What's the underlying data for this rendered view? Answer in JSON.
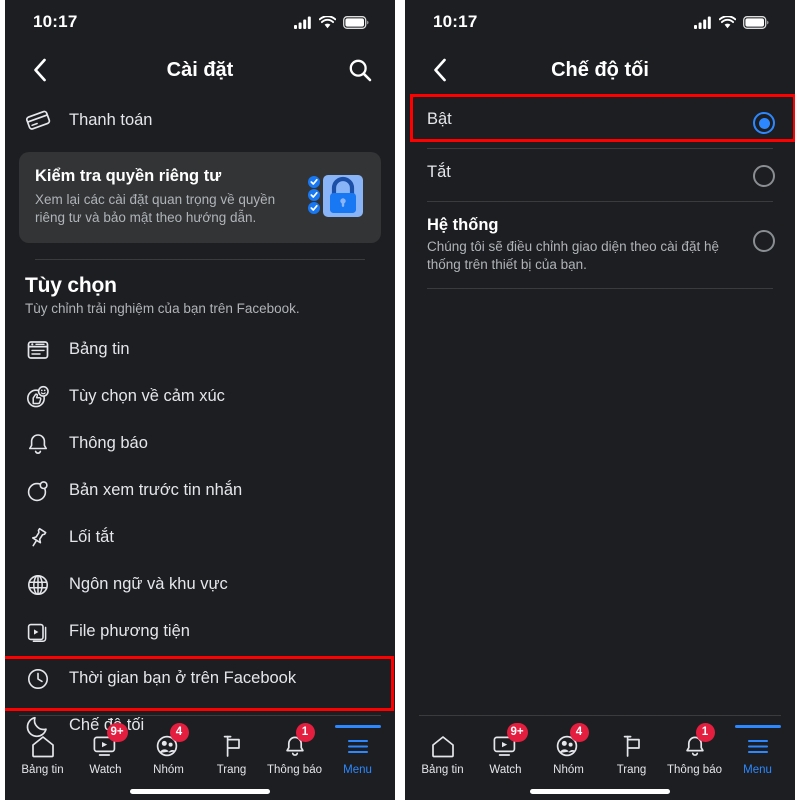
{
  "status_bar": {
    "time": "10:17",
    "signal_icon": "cellular-signal-icon",
    "wifi_icon": "wifi-icon",
    "battery_icon": "battery-icon"
  },
  "left_screen": {
    "nav": {
      "back_icon": "chevron-left-icon",
      "title": "Cài đặt",
      "search_icon": "search-icon"
    },
    "payment_row": {
      "icon": "credit-card-icon",
      "label": "Thanh toán"
    },
    "privacy_card": {
      "title": "Kiểm tra quyền riêng tư",
      "subtitle": "Xem lại các cài đặt quan trọng về quyền riêng tư và bảo mật theo hướng dẫn.",
      "art_icon": "privacy-lock-checklist-icon"
    },
    "section": {
      "title": "Tùy chọn",
      "subtitle": "Tùy chỉnh trải nghiệm của bạn trên Facebook."
    },
    "menu_items": [
      {
        "icon": "news-feed-icon",
        "label": "Bảng tin"
      },
      {
        "icon": "reactions-icon",
        "label": "Tùy chọn về cảm xúc"
      },
      {
        "icon": "bell-icon",
        "label": "Thông báo"
      },
      {
        "icon": "message-preview-icon",
        "label": "Bản xem trước tin nhắn"
      },
      {
        "icon": "pin-icon",
        "label": "Lối tắt"
      },
      {
        "icon": "globe-icon",
        "label": "Ngôn ngữ và khu vực"
      },
      {
        "icon": "media-file-icon",
        "label": "File phương tiện"
      },
      {
        "icon": "clock-icon",
        "label": "Thời gian bạn ở trên Facebook"
      },
      {
        "icon": "moon-icon",
        "label": "Chế độ tối"
      }
    ],
    "highlight_target": "Chế độ tối"
  },
  "right_screen": {
    "nav": {
      "back_icon": "chevron-left-icon",
      "title": "Chế độ tối"
    },
    "options": [
      {
        "title": "Bật",
        "subtitle": "",
        "selected": true
      },
      {
        "title": "Tắt",
        "subtitle": "",
        "selected": false
      },
      {
        "title": "Hệ thống",
        "subtitle": "Chúng tôi sẽ điều chỉnh giao diện theo cài đặt hệ thống trên thiết bị của bạn.",
        "selected": false
      }
    ],
    "highlight_target": "Bật"
  },
  "tab_bar": {
    "tabs": [
      {
        "icon": "home-icon",
        "label": "Bảng tin",
        "badge": "",
        "active": false
      },
      {
        "icon": "watch-icon",
        "label": "Watch",
        "badge": "9+",
        "active": false
      },
      {
        "icon": "groups-icon",
        "label": "Nhóm",
        "badge": "4",
        "active": false
      },
      {
        "icon": "pages-flag-icon",
        "label": "Trang",
        "badge": "",
        "active": false
      },
      {
        "icon": "bell-icon",
        "label": "Thông báo",
        "badge": "1",
        "active": false
      },
      {
        "icon": "hamburger-menu-icon",
        "label": "Menu",
        "badge": "",
        "active": true
      }
    ]
  },
  "colors": {
    "background": "#1c1e21",
    "card": "#323436",
    "accent_blue": "#2d88ff",
    "badge_red": "#e41e3f",
    "highlight_red": "#fe0000",
    "text_primary": "#e4e6eb",
    "text_secondary": "#b0b3b8"
  }
}
